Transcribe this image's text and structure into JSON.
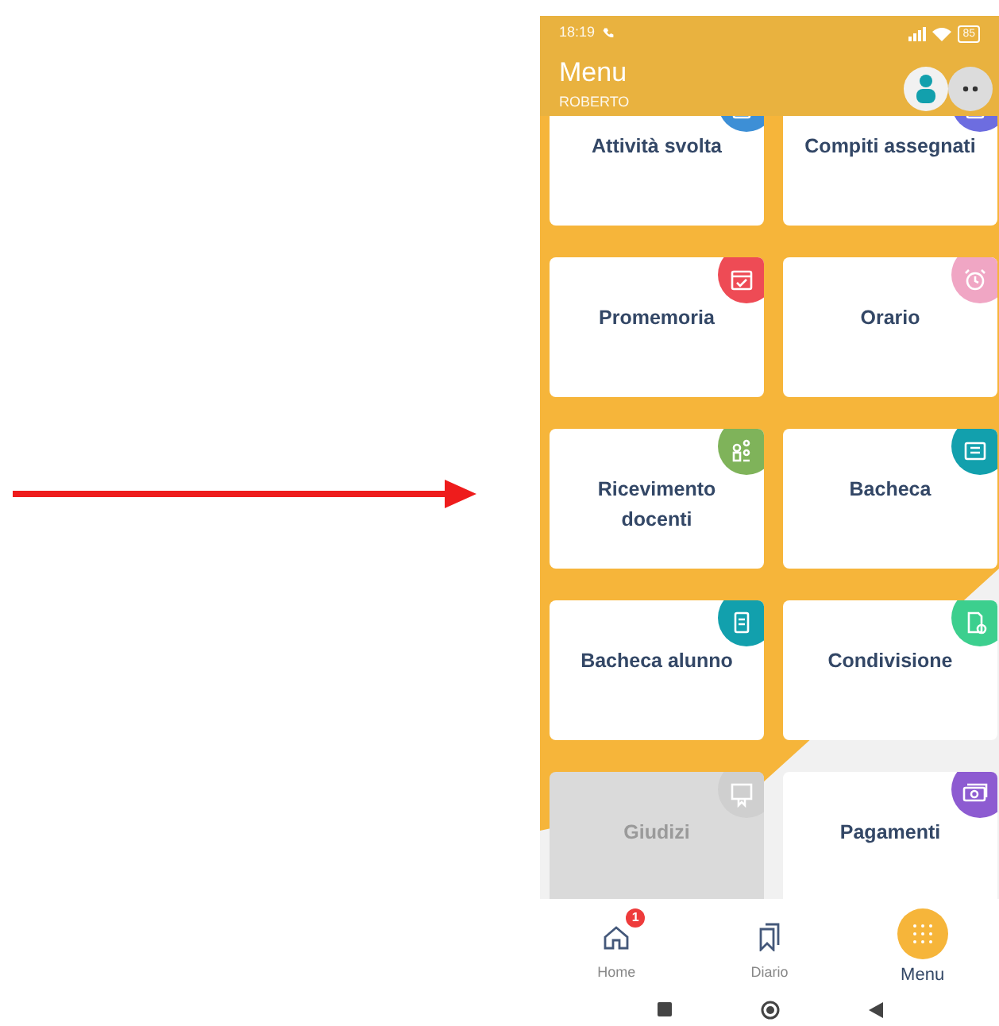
{
  "status_bar": {
    "time": "18:19",
    "battery": "85"
  },
  "header": {
    "title": "Menu",
    "subtitle": "ROBERTO"
  },
  "tiles": [
    {
      "label": "Attività svolta",
      "color": "#3d8fd6",
      "kind": "book",
      "disabled": false
    },
    {
      "label": "Compiti assegnati",
      "color": "#6d6de0",
      "kind": "book",
      "disabled": false
    },
    {
      "label": "Promemoria",
      "color": "#ee4b55",
      "kind": "calendar",
      "disabled": false
    },
    {
      "label": "Orario",
      "color": "#f0a6c4",
      "kind": "alarm",
      "disabled": false
    },
    {
      "label": "Ricevimento docenti",
      "color": "#7fb35a",
      "kind": "people",
      "disabled": false
    },
    {
      "label": "Bacheca",
      "color": "#12a0ad",
      "kind": "board",
      "disabled": false
    },
    {
      "label": "Bacheca alunno",
      "color": "#12a0ad",
      "kind": "clipboard",
      "disabled": false
    },
    {
      "label": "Condivisione",
      "color": "#3ccf8e",
      "kind": "document",
      "disabled": false
    },
    {
      "label": "Giudizi",
      "color": "#cfcfcf",
      "kind": "certificate",
      "disabled": true
    },
    {
      "label": "Pagamenti",
      "color": "#8d5bd1",
      "kind": "money",
      "disabled": false
    }
  ],
  "bottom_nav": [
    {
      "label": "Home",
      "kind": "home",
      "badge": "1",
      "selected": false
    },
    {
      "label": "Diario",
      "kind": "bookmarks",
      "selected": false
    },
    {
      "label": "Menu",
      "kind": "grid",
      "selected": true
    }
  ]
}
